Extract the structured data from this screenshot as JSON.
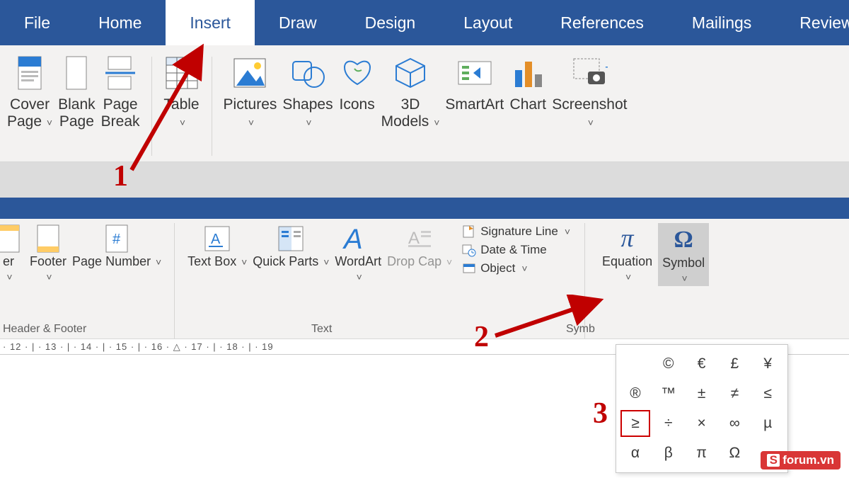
{
  "tabs": {
    "file": "File",
    "home": "Home",
    "insert": "Insert",
    "draw": "Draw",
    "design": "Design",
    "layout": "Layout",
    "references": "References",
    "mailings": "Mailings",
    "review": "Review"
  },
  "ribbon1": {
    "cover_page": "Cover\nPage",
    "blank_page": "Blank\nPage",
    "page_break": "Page\nBreak",
    "table": "Table",
    "pictures": "Pictures",
    "shapes": "Shapes",
    "icons": "Icons",
    "models3d": "3D\nModels",
    "smartart": "SmartArt",
    "chart": "Chart",
    "screenshot": "Screenshot"
  },
  "ribbon2": {
    "header": "er",
    "footer": "Footer",
    "page_number": "Page\nNumber",
    "text_box": "Text\nBox",
    "quick_parts": "Quick\nParts",
    "wordart": "WordArt",
    "drop_cap": "Drop\nCap",
    "signature_line": "Signature Line",
    "date_time": "Date & Time",
    "object": "Object",
    "equation": "Equation",
    "symbol": "Symbol",
    "grp_header_footer": "Header & Footer",
    "grp_text": "Text",
    "grp_symbols": "Symb"
  },
  "ruler": "· 12 · | · 13 · | · 14 · | · 15 · | · 16 · △ · 17 · | · 18 · | · 19",
  "symbols": [
    "",
    "©",
    "€",
    "£",
    "¥",
    "®",
    "™",
    "±",
    "≠",
    "≤",
    "≥",
    "÷",
    "×",
    "∞",
    "µ",
    "α",
    "β",
    "π",
    "Ω",
    ""
  ],
  "symbols_highlight_index": 10,
  "annotations": {
    "n1": "1",
    "n2": "2",
    "n3": "3"
  },
  "watermark_text": "forum.vn",
  "watermark_badge": "S"
}
